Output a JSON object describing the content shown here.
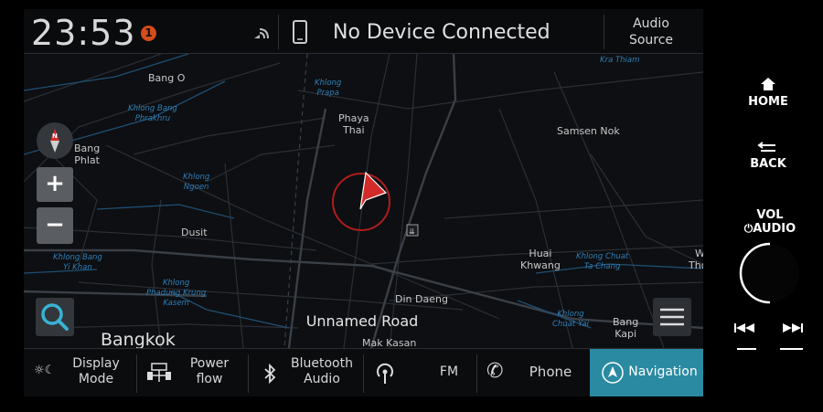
{
  "status": {
    "time": "23:53",
    "notification_count": "1",
    "device_status": "No Device Connected",
    "audio_source_line1": "Audio",
    "audio_source_line2": "Source"
  },
  "map": {
    "road_name": "Unnamed Road",
    "labels": {
      "bang_o": "Bang O",
      "bang_phlat_1": "Bang",
      "bang_phlat_2": "Phlat",
      "phaya_thai_1": "Phaya",
      "phaya_thai_2": "Thai",
      "samsen_nok": "Samsen Nok",
      "dusit": "Dusit",
      "huai_khwang_1": "Huai",
      "huai_khwang_2": "Khwang",
      "din_daeng": "Din Daeng",
      "bang_kapi_1": "Bang",
      "bang_kapi_2": "Kapi",
      "mak_kasan": "Mak Kasan",
      "bangkok": "Bangkok",
      "edge_w": "W",
      "edge_thor": "Thor"
    },
    "water_labels": {
      "khlong_prapa_1": "Khlong",
      "khlong_prapa_2": "Prapa",
      "kra_thiam": "Kra Thiam",
      "khlong_bang_phrakhru_1": "Khlong Bang",
      "khlong_bang_phrakhru_2": "Phrakhru",
      "khlong_ngoen_1": "Khlong",
      "khlong_ngoen_2": "Ngoen",
      "khlong_bang_yi_khan_1": "Khlong Bang",
      "khlong_bang_yi_khan_2": "Yi Khan",
      "khlong_phadung_1": "Khlong",
      "khlong_phadung_2": "Phadung Krung",
      "khlong_phadung_3": "Kasem",
      "khlong_chuat_ta_chang_1": "Khlong Chuat",
      "khlong_chuat_ta_chang_2": "Ta Chang",
      "khlong_chuat_yai_1": "Khlong",
      "khlong_chuat_yai_2": "Chuat Yai"
    },
    "zoom_in": "+",
    "zoom_out": "−"
  },
  "bottom_bar": {
    "display_mode_1": "Display",
    "display_mode_2": "Mode",
    "power_flow_1": "Power",
    "power_flow_2": "flow",
    "bluetooth_audio_1": "Bluetooth",
    "bluetooth_audio_2": "Audio",
    "fm": "FM",
    "phone": "Phone",
    "navigation": "Navigation"
  },
  "hard_keys": {
    "home": "HOME",
    "back": "BACK",
    "vol": "VOL",
    "audio": "AUDIO"
  },
  "colors": {
    "accent": "#2a8aa2",
    "position_marker": "#cc2222",
    "water_label": "#2f7fb8"
  }
}
